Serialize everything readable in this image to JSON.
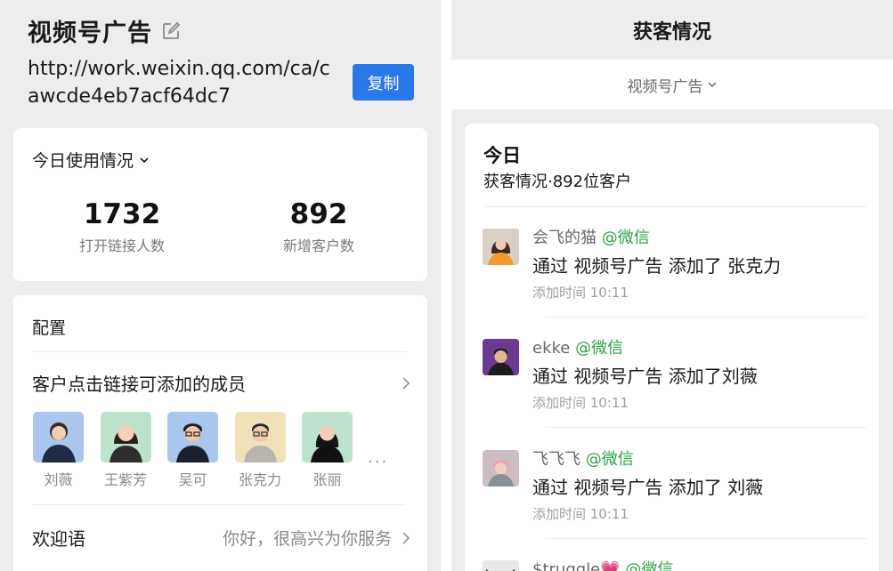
{
  "left": {
    "title": "视频号广告",
    "url": "http://work.weixin.qq.com/ca/cawcde4eb7acf64dc7",
    "copy_label": "复制",
    "usage": {
      "header": "今日使用情况",
      "stats": [
        {
          "value": "1732",
          "label": "打开链接人数"
        },
        {
          "value": "892",
          "label": "新增客户数"
        }
      ]
    },
    "config": {
      "title": "配置",
      "members_label": "客户点击链接可添加的成员",
      "members": [
        {
          "name": "刘薇"
        },
        {
          "name": "王紫芳"
        },
        {
          "name": "吴可"
        },
        {
          "name": "张克力"
        },
        {
          "name": "张丽"
        }
      ],
      "more": "···",
      "welcome_label": "欢迎语",
      "welcome_value": "你好，很高兴为你服务"
    }
  },
  "right": {
    "header": "获客情况",
    "filter": "视频号广告",
    "today": {
      "title": "今日",
      "subtitle": "获客情况·892位客户",
      "items": [
        {
          "user": "会飞的猫",
          "source": "@微信",
          "message": "通过 视频号广告 添加了 张克力",
          "time": "添加时间 10:11"
        },
        {
          "user": "ekke",
          "source": "@微信",
          "message": "通过 视频号广告 添加了刘薇",
          "time": "添加时间 10:11"
        },
        {
          "user": "飞飞飞",
          "source": "@微信",
          "message": "通过 视频号广告 添加了 刘薇",
          "time": "添加时间 10:11"
        },
        {
          "user": "$truggle💗",
          "source": "@微信",
          "message": "",
          "time": ""
        }
      ]
    }
  },
  "colors": {
    "accent": "#2878e9",
    "wechat_green": "#2ba245",
    "panel_bg": "#ededed"
  }
}
